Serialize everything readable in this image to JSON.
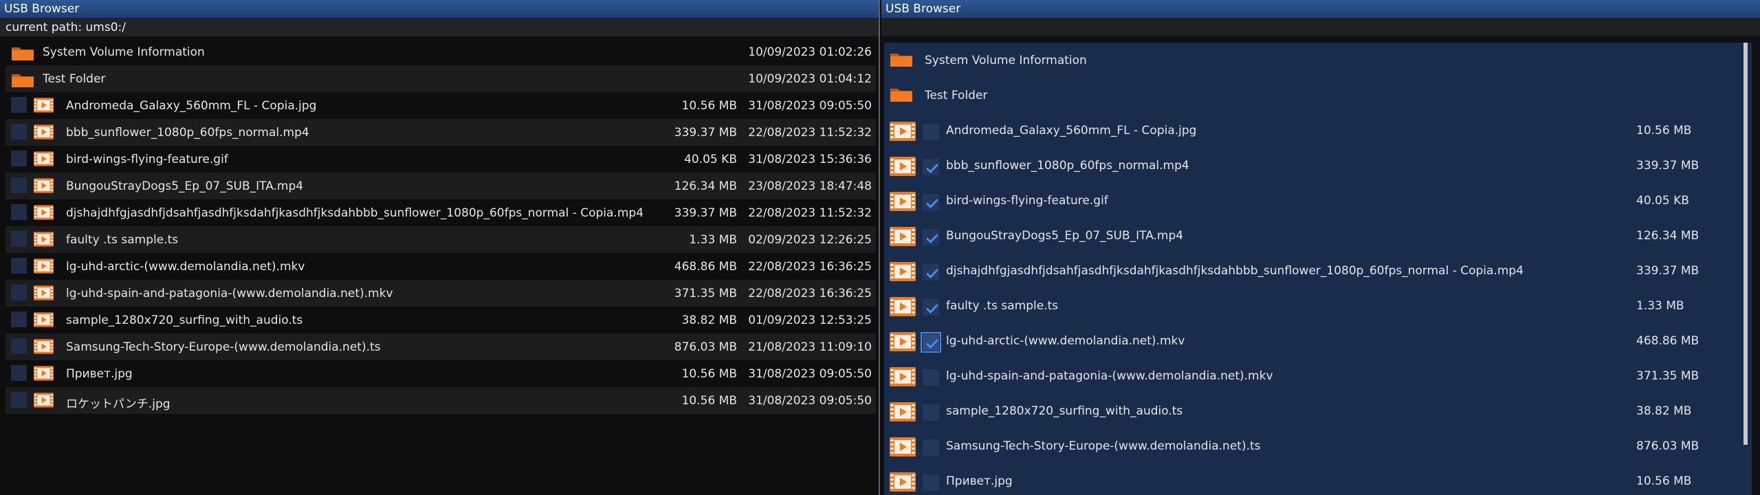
{
  "left_window": {
    "title": "USB Browser",
    "path_label": "current path: ums0:/",
    "items": [
      {
        "type": "folder",
        "name": "System Volume Information",
        "size": "",
        "date": "10/09/2023 01:02:26"
      },
      {
        "type": "folder",
        "name": "Test Folder",
        "size": "",
        "date": "10/09/2023 01:04:12"
      },
      {
        "type": "file",
        "name": "Andromeda_Galaxy_560mm_FL - Copia.jpg",
        "size": "10.56 MB",
        "date": "31/08/2023 09:05:50"
      },
      {
        "type": "file",
        "name": "bbb_sunflower_1080p_60fps_normal.mp4",
        "size": "339.37 MB",
        "date": "22/08/2023 11:52:32"
      },
      {
        "type": "file",
        "name": "bird-wings-flying-feature.gif",
        "size": "40.05 KB",
        "date": "31/08/2023 15:36:36"
      },
      {
        "type": "file",
        "name": "BungouStrayDogs5_Ep_07_SUB_ITA.mp4",
        "size": "126.34 MB",
        "date": "23/08/2023 18:47:48"
      },
      {
        "type": "file",
        "name": "djshajdhfgjasdhfjdsahfjasdhfjksdahfjkasdhfjksdahbbb_sunflower_1080p_60fps_normal - Copia.mp4",
        "size": "339.37 MB",
        "date": "22/08/2023 11:52:32"
      },
      {
        "type": "file",
        "name": "faulty .ts sample.ts",
        "size": "1.33 MB",
        "date": "02/09/2023 12:26:25"
      },
      {
        "type": "file",
        "name": "lg-uhd-arctic-(www.demolandia.net).mkv",
        "size": "468.86 MB",
        "date": "22/08/2023 16:36:25"
      },
      {
        "type": "file",
        "name": "lg-uhd-spain-and-patagonia-(www.demolandia.net).mkv",
        "size": "371.35 MB",
        "date": "22/08/2023 16:36:25"
      },
      {
        "type": "file",
        "name": "sample_1280x720_surfing_with_audio.ts",
        "size": "38.82 MB",
        "date": "01/09/2023 12:53:25"
      },
      {
        "type": "file",
        "name": "Samsung-Tech-Story-Europe-(www.demolandia.net).ts",
        "size": "876.03 MB",
        "date": "21/08/2023 11:09:10"
      },
      {
        "type": "file",
        "name": "Привет.jpg",
        "size": "10.56 MB",
        "date": "31/08/2023 09:05:50"
      },
      {
        "type": "file",
        "name": "ロケットパンチ.jpg",
        "size": "10.56 MB",
        "date": "31/08/2023 09:05:50"
      }
    ]
  },
  "right_window": {
    "title": "USB Browser",
    "items": [
      {
        "type": "folder",
        "name": "System Volume Information",
        "size": ""
      },
      {
        "type": "folder",
        "name": "Test Folder",
        "size": ""
      },
      {
        "type": "file",
        "name": "Andromeda_Galaxy_560mm_FL - Copia.jpg",
        "size": "10.56 MB",
        "checked": false
      },
      {
        "type": "file",
        "name": "bbb_sunflower_1080p_60fps_normal.mp4",
        "size": "339.37 MB",
        "checked": true
      },
      {
        "type": "file",
        "name": "bird-wings-flying-feature.gif",
        "size": "40.05 KB",
        "checked": true
      },
      {
        "type": "file",
        "name": "BungouStrayDogs5_Ep_07_SUB_ITA.mp4",
        "size": "126.34 MB",
        "checked": true
      },
      {
        "type": "file",
        "name": "djshajdhfgjasdhfjdsahfjasdhfjksdahfjkasdhfjksdahbbb_sunflower_1080p_60fps_normal - Copia.mp4",
        "size": "339.37 MB",
        "checked": true
      },
      {
        "type": "file",
        "name": "faulty .ts sample.ts",
        "size": "1.33 MB",
        "checked": true
      },
      {
        "type": "file",
        "name": "lg-uhd-arctic-(www.demolandia.net).mkv",
        "size": "468.86 MB",
        "checked": true,
        "focused": true
      },
      {
        "type": "file",
        "name": "lg-uhd-spain-and-patagonia-(www.demolandia.net).mkv",
        "size": "371.35 MB",
        "checked": false
      },
      {
        "type": "file",
        "name": "sample_1280x720_surfing_with_audio.ts",
        "size": "38.82 MB",
        "checked": false
      },
      {
        "type": "file",
        "name": "Samsung-Tech-Story-Europe-(www.demolandia.net).ts",
        "size": "876.03 MB",
        "checked": false
      },
      {
        "type": "file",
        "name": "Привет.jpg",
        "size": "10.56 MB",
        "checked": false
      }
    ]
  },
  "icons": {
    "folder": "folder-icon",
    "file": "video-file-icon",
    "check": "checkmark-icon"
  },
  "colors": {
    "folder": "#f07a22",
    "file_icon": "#ef7a22",
    "selection_bg": "#1a2c4c",
    "titlebar": "#2a4f8a"
  }
}
